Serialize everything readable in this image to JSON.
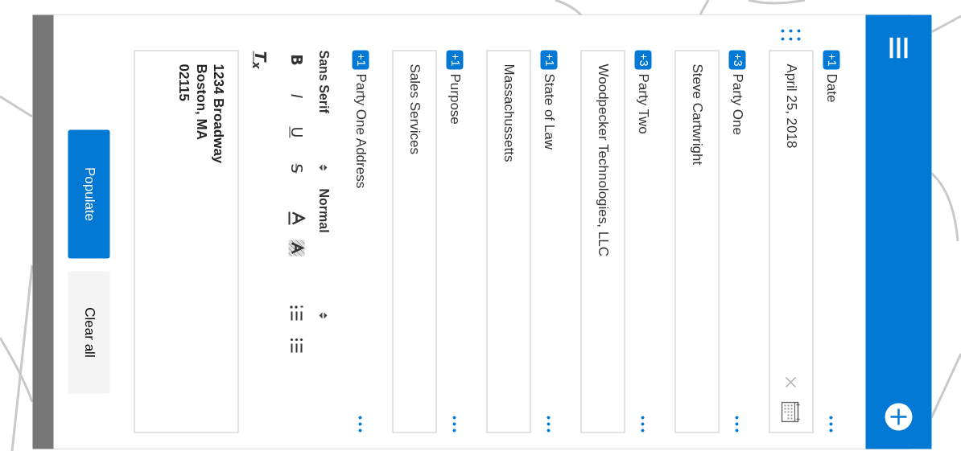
{
  "fields": [
    {
      "kind": "date",
      "label": "Date",
      "badge": "+1",
      "value": "April 25, 2018",
      "show_handle": true
    },
    {
      "kind": "text",
      "label": "Party One",
      "badge": "+3",
      "value": "Steve Cartwright",
      "show_handle": false
    },
    {
      "kind": "text",
      "label": "Party Two",
      "badge": "+3",
      "value": "Woodpecker Technologies, LLC",
      "show_handle": false
    },
    {
      "kind": "text",
      "label": "State of Law",
      "badge": "+1",
      "value": "Massachussetts",
      "show_handle": false
    },
    {
      "kind": "text",
      "label": "Purpose",
      "badge": "+1",
      "value": "Sales Services",
      "show_handle": false
    },
    {
      "kind": "richtext",
      "label": "Party One Address",
      "badge": "+1",
      "show_handle": false,
      "font": "Sans Serif",
      "size": "Normal",
      "formats": [
        {
          "kind": "bold",
          "text": "B"
        },
        {
          "kind": "italic",
          "text": "I"
        },
        {
          "kind": "underline",
          "text": "U"
        },
        {
          "kind": "strike",
          "text": "S"
        },
        {
          "kind": "color"
        },
        {
          "kind": "background"
        },
        {
          "kind": "ordered"
        },
        {
          "kind": "bullet"
        },
        {
          "kind": "clean",
          "text": "T$_{x}$"
        }
      ],
      "lines": [
        "1234 Broadway",
        "Boston, MA",
        "02115"
      ]
    }
  ],
  "buttons": [
    {
      "kind": "primary",
      "label": "Populate"
    },
    {
      "kind": "secondary",
      "label": "Clear all"
    }
  ]
}
